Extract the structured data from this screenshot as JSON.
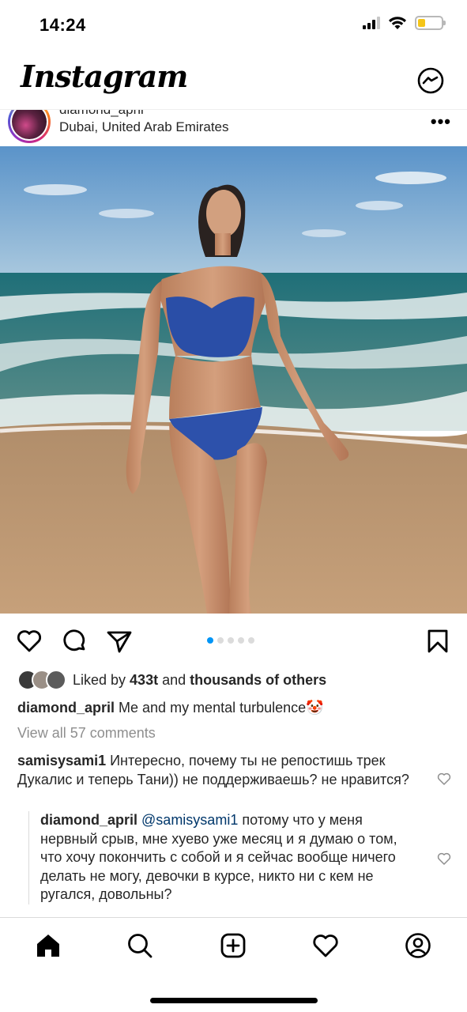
{
  "status_bar": {
    "time": "14:24"
  },
  "header": {
    "logo": "Instagram",
    "messenger_icon": "messenger-icon"
  },
  "post": {
    "username": "diamond_april",
    "location": "Dubai, United Arab Emirates",
    "more_icon": "more-dots-icon",
    "carousel": {
      "count": 5,
      "active_index": 0
    },
    "likes": {
      "prefix": "Liked by ",
      "user": "433t",
      "middle": " and ",
      "rest": "thousands of others"
    },
    "caption": {
      "username": "diamond_april",
      "text": " Me and my mental turbulence",
      "emoji": "🤡"
    },
    "view_all_comments": "View all 57 comments",
    "comments": [
      {
        "username": "samisysami1",
        "text": " Интересно, почему ты не репостишь трек Дукалис и теперь Тани)) не поддерживаешь? не нравится?"
      }
    ],
    "replies": [
      {
        "username": "diamond_april",
        "mention": " @samisysami1",
        "text": " потому что у меня нервный срыв, мне хуево уже месяц и я думаю о том, что хочу покончить с собой и я сейчас вообще ничего делать не могу, девочки в курсе, никто ни с кем не ругался, довольны?"
      }
    ]
  },
  "bottom_nav": {
    "items": [
      "home-icon",
      "search-icon",
      "new-post-icon",
      "activity-heart-icon",
      "profile-icon"
    ]
  },
  "colors": {
    "accent_blue": "#0095f6",
    "text": "#262626",
    "muted": "#8e8e8e",
    "mention": "#00376b"
  }
}
